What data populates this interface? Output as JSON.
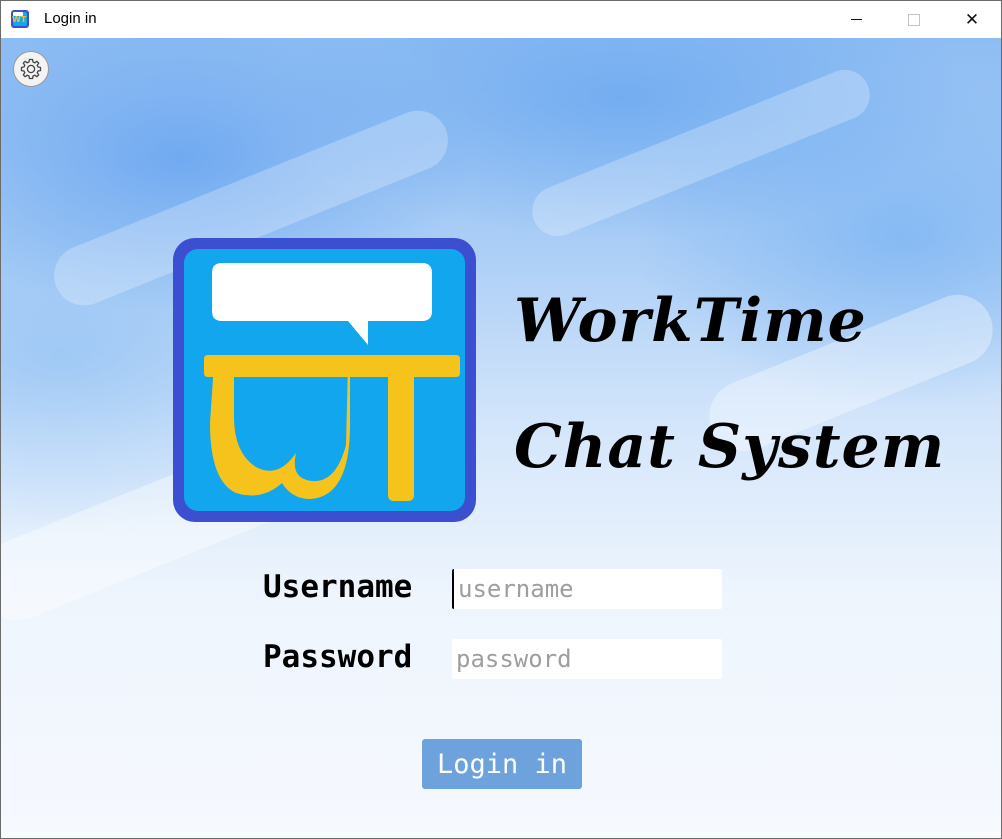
{
  "window": {
    "title": "Login in",
    "close_glyph": "✕"
  },
  "brand": {
    "line1": "WorkTime",
    "line2": "Chat System",
    "logo_text": "WT"
  },
  "form": {
    "username_label": "Username",
    "username_placeholder": "username",
    "username_value": "",
    "password_label": "Password",
    "password_placeholder": "password",
    "password_value": "",
    "submit_label": "Login in"
  },
  "icons": {
    "settings": "gear-icon",
    "app": "worktime-app-icon"
  },
  "colors": {
    "logo_frame": "#3b4fd0",
    "logo_fill": "#12a6ee",
    "logo_letters": "#f6c21c",
    "button": "#6ea2dc"
  }
}
